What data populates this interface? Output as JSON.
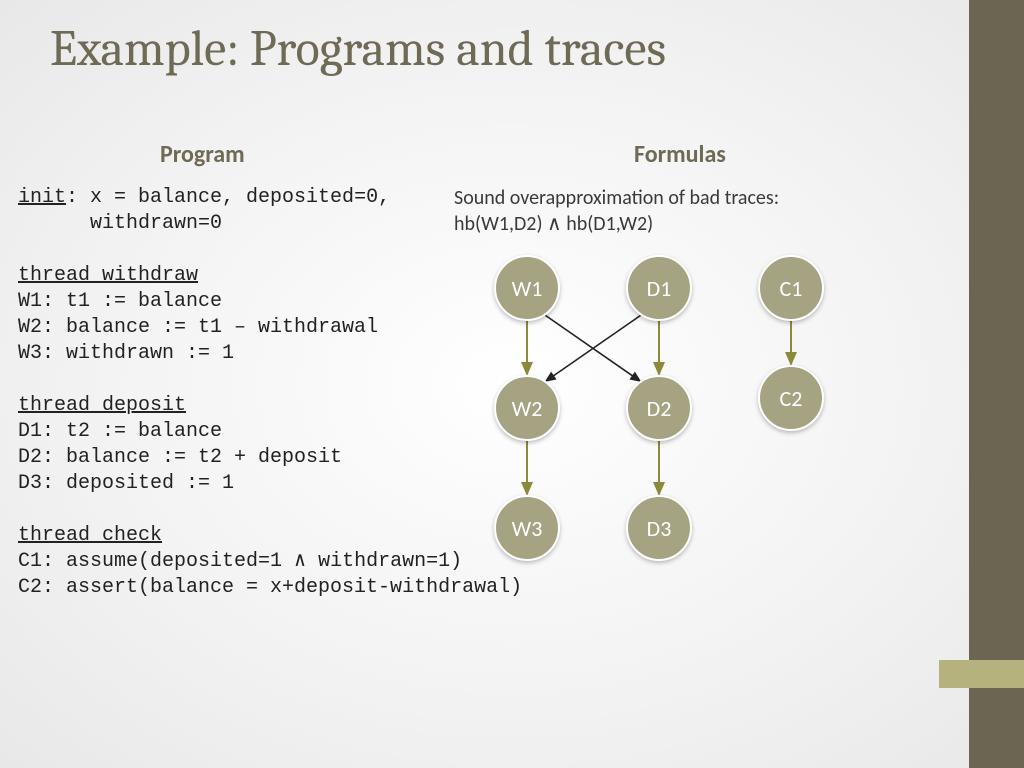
{
  "title": "Example: Programs and traces",
  "headings": {
    "program": "Program",
    "formulas": "Formulas"
  },
  "program": {
    "init_label": "init",
    "init_body": ": x = balance, deposited=0,\n      withdrawn=0",
    "withdraw_label": "thread_withdraw",
    "withdraw_lines": "W1: t1 := balance\nW2: balance := t1 – withdrawal\nW3: withdrawn := 1",
    "deposit_label": "thread_deposit",
    "deposit_lines": "D1: t2 := balance\nD2: balance := t2 + deposit\nD3: deposited := 1",
    "check_label": "thread_check",
    "check_lines": "C1: assume(deposited=1 ∧ withdrawn=1)\nC2: assert(balance = x+deposit-withdrawal)"
  },
  "formulas": {
    "line1": "Sound overapproximation of bad traces:",
    "line2": "hb(W1,D2) ∧ hb(D1,W2)"
  },
  "graph": {
    "nodes": {
      "W1": "W1",
      "W2": "W2",
      "W3": "W3",
      "D1": "D1",
      "D2": "D2",
      "D3": "D3",
      "C1": "C1",
      "C2": "C2"
    }
  }
}
